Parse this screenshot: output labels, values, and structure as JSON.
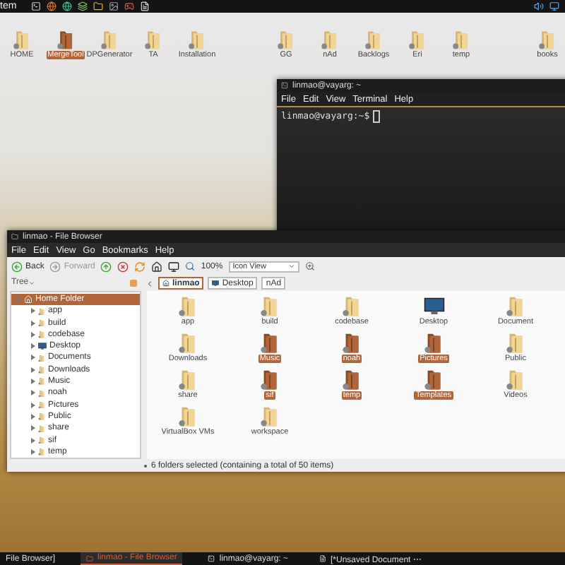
{
  "top_panel": {
    "menu_label": "tem"
  },
  "desktop_icons": [
    {
      "label": "HOME",
      "selected": false
    },
    {
      "label": "MergeTool",
      "selected": true
    },
    {
      "label": "DPGenerator",
      "selected": false
    },
    {
      "label": "TA",
      "selected": false
    },
    {
      "label": "Installation",
      "selected": false
    },
    {
      "label": "GG",
      "selected": false
    },
    {
      "label": "nAd",
      "selected": false
    },
    {
      "label": "Backlogs",
      "selected": false
    },
    {
      "label": "Eri",
      "selected": false
    },
    {
      "label": "temp",
      "selected": false
    },
    {
      "label": "books",
      "selected": false
    }
  ],
  "terminal": {
    "title": "linmao@vayarg: ~",
    "menu": [
      "File",
      "Edit",
      "View",
      "Terminal",
      "Help"
    ],
    "prompt": "linmao@vayarg:~$"
  },
  "file_browser": {
    "title": "linmao - File Browser",
    "menu": [
      "File",
      "Edit",
      "View",
      "Go",
      "Bookmarks",
      "Help"
    ],
    "toolbar": {
      "nav": [
        {
          "label": "Back",
          "disabled": false
        },
        {
          "label": "Forward",
          "disabled": true
        }
      ],
      "zoom": "100%",
      "view_mode": "Icon View"
    },
    "sidebar": {
      "mode": "Tree",
      "tree": [
        {
          "label": "Home Folder",
          "kind": "home",
          "expanded": true,
          "selected": true,
          "children": [
            {
              "label": "app",
              "kind": "folder",
              "expanded": false,
              "selected": false
            },
            {
              "label": "build",
              "kind": "folder",
              "expanded": false,
              "selected": false
            },
            {
              "label": "codebase",
              "kind": "folder",
              "expanded": false,
              "selected": false
            },
            {
              "label": "Desktop",
              "kind": "desktop",
              "expanded": false,
              "selected": false
            },
            {
              "label": "Documents",
              "kind": "folder",
              "expanded": false,
              "selected": false
            },
            {
              "label": "Downloads",
              "kind": "folder",
              "expanded": false,
              "selected": false
            },
            {
              "label": "Music",
              "kind": "folder",
              "expanded": false,
              "selected": false
            },
            {
              "label": "noah",
              "kind": "folder",
              "expanded": false,
              "selected": false
            },
            {
              "label": "Pictures",
              "kind": "folder",
              "expanded": false,
              "selected": false
            },
            {
              "label": "Public",
              "kind": "folder",
              "expanded": false,
              "selected": false
            },
            {
              "label": "share",
              "kind": "folder",
              "expanded": false,
              "selected": false
            },
            {
              "label": "sif",
              "kind": "folder",
              "expanded": false,
              "selected": false
            },
            {
              "label": "temp",
              "kind": "folder",
              "expanded": false,
              "selected": false
            }
          ]
        }
      ]
    },
    "path": [
      {
        "label": "linmao",
        "selected": true
      },
      {
        "label": "Desktop",
        "selected": false
      },
      {
        "label": "nAd",
        "selected": false
      }
    ],
    "items": [
      {
        "label": "app",
        "kind": "folder",
        "selected": false
      },
      {
        "label": "build",
        "kind": "folder",
        "selected": false
      },
      {
        "label": "codebase",
        "kind": "folder",
        "selected": false
      },
      {
        "label": "Desktop",
        "kind": "desktop",
        "selected": false
      },
      {
        "label": "Document",
        "kind": "folder",
        "selected": false
      },
      {
        "label": "Downloads",
        "kind": "folder",
        "selected": false
      },
      {
        "label": "Music",
        "kind": "folder",
        "selected": true
      },
      {
        "label": "noah",
        "kind": "folder",
        "selected": true
      },
      {
        "label": "Pictures",
        "kind": "folder",
        "selected": true
      },
      {
        "label": "Public",
        "kind": "folder",
        "selected": false
      },
      {
        "label": "share",
        "kind": "folder",
        "selected": false
      },
      {
        "label": "sif",
        "kind": "folder",
        "selected": true
      },
      {
        "label": "temp",
        "kind": "folder",
        "selected": true
      },
      {
        "label": "Templates",
        "kind": "folder",
        "selected": true
      },
      {
        "label": "Videos",
        "kind": "folder",
        "selected": false
      },
      {
        "label": "VirtualBox VMs",
        "kind": "folder",
        "selected": false
      },
      {
        "label": "workspace",
        "kind": "folder",
        "selected": false
      }
    ],
    "status": "6 folders selected (containing a total of 50 items)"
  },
  "taskbar": [
    {
      "label": "File Browser]",
      "selected": false
    },
    {
      "label": "linmao - File Browser",
      "selected": true
    },
    {
      "label": "linmao@vayarg: ~",
      "selected": false
    },
    {
      "label": "[*Unsaved Document ⋯",
      "selected": false
    }
  ]
}
